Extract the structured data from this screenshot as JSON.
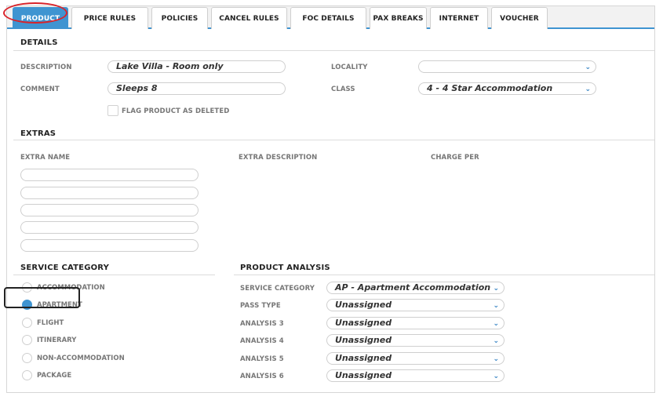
{
  "tabs": [
    {
      "label": "PRODUCT",
      "active": true
    },
    {
      "label": "PRICE RULES"
    },
    {
      "label": "POLICIES"
    },
    {
      "label": "CANCEL RULES"
    },
    {
      "label": "FOC DETAILS"
    },
    {
      "label": "PAX BREAKS"
    },
    {
      "label": "INTERNET"
    },
    {
      "label": "VOUCHER"
    }
  ],
  "details": {
    "title": "DETAILS",
    "description_label": "DESCRIPTION",
    "description_value": "Lake Villa - Room only",
    "comment_label": "COMMENT",
    "comment_value": "Sleeps 8",
    "locality_label": "LOCALITY",
    "locality_value": "",
    "class_label": "CLASS",
    "class_value": "4 - 4 Star Accommodation",
    "flag_deleted_label": "FLAG PRODUCT AS DELETED",
    "flag_deleted_checked": false
  },
  "extras": {
    "title": "EXTRAS",
    "col_name": "EXTRA NAME",
    "col_description": "EXTRA DESCRIPTION",
    "col_charge": "CHARGE PER",
    "rows": [
      "",
      "",
      "",
      "",
      ""
    ]
  },
  "service_category": {
    "title": "SERVICE CATEGORY",
    "options": [
      "ACCOMMODATION",
      "APARTMENT",
      "FLIGHT",
      "ITINERARY",
      "NON-ACCOMMODATION",
      "PACKAGE"
    ],
    "selected": "APARTMENT"
  },
  "product_analysis": {
    "title": "PRODUCT ANALYSIS",
    "rows": [
      {
        "label": "SERVICE CATEGORY",
        "value": "AP - Apartment Accommodation"
      },
      {
        "label": "PASS TYPE",
        "value": "Unassigned"
      },
      {
        "label": "ANALYSIS 3",
        "value": "Unassigned"
      },
      {
        "label": "ANALYSIS 4",
        "value": "Unassigned"
      },
      {
        "label": "ANALYSIS 5",
        "value": "Unassigned"
      },
      {
        "label": "ANALYSIS 6",
        "value": "Unassigned"
      }
    ]
  },
  "icons": {
    "dropdown": "chevron-down-icon"
  },
  "colors": {
    "accent": "#3f94d1",
    "highlight_red": "#d9232a"
  }
}
